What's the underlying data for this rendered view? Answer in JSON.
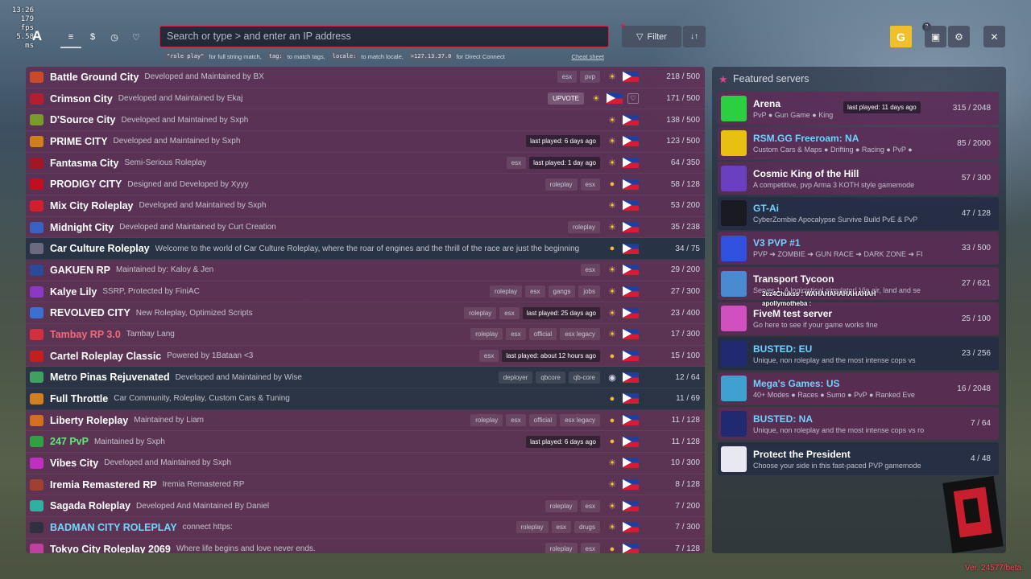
{
  "perf": {
    "time": "13:26",
    "fps": "179 fps",
    "ms": "5.58 ms"
  },
  "nav": {
    "logo": "A",
    "tabs": [
      {
        "icon": "list-icon",
        "glyph": "≡"
      },
      {
        "icon": "dollar-icon",
        "glyph": "$"
      },
      {
        "icon": "history-icon",
        "glyph": "◷"
      },
      {
        "icon": "heart-icon",
        "glyph": "♡"
      }
    ]
  },
  "search": {
    "placeholder": "Search or type > and enter an IP address",
    "hints": [
      {
        "code": "\"role play\"",
        "text": "for full string match,"
      },
      {
        "code": "tag:",
        "text": "to match tags,"
      },
      {
        "code": "locale:",
        "text": "to match locale,"
      },
      {
        "code": ">127.13.37.0",
        "text": "for Direct Connect"
      }
    ],
    "cheat": "Cheat sheet"
  },
  "toolbar": {
    "filter": "Filter",
    "sort_glyph": "↓↑",
    "avatar": "G",
    "notif_count": "2",
    "close_glyph": "✕",
    "settings_glyph": "⚙",
    "notif_glyph": "▣"
  },
  "colors": {
    "accent": "#d81e3c",
    "featured_star": "#e3418a"
  },
  "servers": [
    {
      "name": "Battle Ground City",
      "desc": "Developed and Maintained by BX",
      "tags": [
        "esx",
        "pvp"
      ],
      "players": "218 / 500",
      "style": "pink",
      "icon": "#c84a2a",
      "status": "sun"
    },
    {
      "name": "Crimson City",
      "desc": "Developed and Maintained by Ekaj",
      "upvote": "UPVOTE",
      "heart": true,
      "players": "171 / 500",
      "style": "pink",
      "icon": "#b02030",
      "status": "sun"
    },
    {
      "name": "D'Source City",
      "desc": "Developed and Maintained by Sxph",
      "players": "138 / 500",
      "style": "pink",
      "icon": "#7a9a2a",
      "status": "sun"
    },
    {
      "name": "PRIME CITY",
      "desc": "Developed and Maintained by Sxph",
      "last": "last played: 6 days ago",
      "players": "123 / 500",
      "style": "pink",
      "icon": "#d0801a",
      "status": "sun"
    },
    {
      "name": "Fantasma City",
      "desc": "Semi-Serious Roleplay",
      "tags": [
        "esx"
      ],
      "last": "last played: 1 day ago",
      "players": "64 / 350",
      "style": "pink",
      "icon": "#a01828",
      "status": "sun"
    },
    {
      "name": "PRODIGY CITY",
      "desc": "Designed and Developed by Xyyy",
      "tags": [
        "roleplay",
        "esx"
      ],
      "players": "58 / 128",
      "style": "pink",
      "icon": "#c01020",
      "status": "orb"
    },
    {
      "name": "Mix City Roleplay",
      "desc": "Developed and Maintained by Sxph",
      "players": "53 / 200",
      "style": "pink",
      "icon": "#d02030",
      "status": "sun"
    },
    {
      "name": "Midnight City",
      "desc": "Developed and Maintained by Curt Creation",
      "tags": [
        "roleplay"
      ],
      "players": "35 / 238",
      "style": "pink",
      "icon": "#3a60c0",
      "status": "sun"
    },
    {
      "name": "Car Culture Roleplay",
      "desc": "Welcome to the world of Car Culture Roleplay, where the roar of engines and the thrill of the race are just the beginning",
      "players": "34 / 75",
      "style": "blue",
      "icon": "#6a6a80",
      "status": "orb"
    },
    {
      "name": "GAKUEN RP",
      "desc": "Maintained by: Kaloy & Jen",
      "tags": [
        "esx"
      ],
      "players": "29 / 200",
      "style": "pink",
      "icon": "#2a4a9a",
      "status": "sun"
    },
    {
      "name": "Kalye Lily",
      "desc": "SSRP, Protected by FiniAC",
      "tags": [
        "roleplay",
        "esx",
        "gangs",
        "jobs"
      ],
      "players": "27 / 300",
      "style": "pink",
      "icon": "#8a3ac0",
      "status": "sun"
    },
    {
      "name": "REVOLVED CITY",
      "desc": "New Roleplay, Optimized Scripts",
      "tags": [
        "roleplay",
        "esx"
      ],
      "last": "last played: 25 days ago",
      "players": "23 / 400",
      "style": "pink",
      "icon": "#3a70d0",
      "status": "sun"
    },
    {
      "name": "Tambay RP 3.0",
      "desc": "Tambay Lang",
      "tags": [
        "roleplay",
        "esx",
        "official",
        "esx legacy"
      ],
      "players": "17 / 300",
      "style": "pink",
      "icon": "#d03040",
      "status": "sun",
      "color": "red"
    },
    {
      "name": "Cartel Roleplay Classic",
      "desc": "Powered by 1Bataan <3",
      "tags": [
        "esx"
      ],
      "last": "last played: about 12 hours ago",
      "players": "15 / 100",
      "style": "pink",
      "icon": "#c02020",
      "status": "orb"
    },
    {
      "name": "Metro Pinas Rejuvenated",
      "desc": "Developed and Maintained by Wise",
      "tags": [
        "deployer",
        "qbcore",
        "qb-core"
      ],
      "players": "12 / 64",
      "style": "blue",
      "icon": "#40a060",
      "status": "moon"
    },
    {
      "name": "Full Throttle",
      "desc": "Car Community, Roleplay, Custom Cars & Tuning",
      "players": "11 / 69",
      "style": "blue",
      "icon": "#d08020",
      "status": "orb"
    },
    {
      "name": "Liberty Roleplay",
      "desc": "Maintained by Liam",
      "tags": [
        "roleplay",
        "esx",
        "official",
        "esx legacy"
      ],
      "players": "11 / 128",
      "style": "pink",
      "icon": "#d07020",
      "status": "orb"
    },
    {
      "name": "247 PvP",
      "desc": "Maintained by Sxph",
      "last": "last played: 6 days ago",
      "players": "11 / 128",
      "style": "pink",
      "icon": "#30a040",
      "status": "orb",
      "color": "green"
    },
    {
      "name": "Vibes City",
      "desc": "Developed and Maintained by Sxph",
      "players": "10 / 300",
      "style": "pink",
      "icon": "#c030c0",
      "status": "sun"
    },
    {
      "name": "Iremia Remastered RP",
      "desc": "Iremia Remastered RP",
      "players": "8 / 128",
      "style": "pink",
      "icon": "#a04030",
      "status": "sun"
    },
    {
      "name": "Sagada Roleplay",
      "desc": "Developed And Maintained By Daniel",
      "tags": [
        "roleplay",
        "esx"
      ],
      "players": "7 / 200",
      "style": "pink",
      "icon": "#30b0a0",
      "status": "sun"
    },
    {
      "name": "BADMAN CITY ROLEPLAY",
      "desc": "connect https:",
      "tags": [
        "roleplay",
        "esx",
        "drugs"
      ],
      "players": "7 / 300",
      "style": "pink",
      "icon": "#303040",
      "status": "sun",
      "color": "cyan"
    },
    {
      "name": "Tokyo City Roleplay 2069",
      "desc": "Where life begins and love never ends.",
      "tags": [
        "roleplay",
        "esx"
      ],
      "players": "7 / 128",
      "style": "pink",
      "icon": "#c040a0",
      "status": "orb"
    }
  ],
  "featured": {
    "title": "Featured servers",
    "items": [
      {
        "name": "Arena",
        "desc": "PvP ● Gun Game ● King",
        "last": "last played: 11 days ago",
        "players": "315 / 2048",
        "style": "pink",
        "icon": "#2ad040"
      },
      {
        "name": "RSM.GG Freeroam: NA",
        "desc": "Custom Cars & Maps ● Drifting ● Racing ● PvP ●",
        "players": "85 / 2000",
        "style": "pink",
        "icon": "#e8c010",
        "cyan": true
      },
      {
        "name": "Cosmic King of the Hill",
        "desc": "A competitive, pvp Arma 3 KOTH style gamemode",
        "players": "57 / 300",
        "style": "pink",
        "icon": "#6a40c0"
      },
      {
        "name": "GT-Ai",
        "desc": "CyberZombie Apocalypse Survive Build PvE & PvP",
        "players": "47 / 128",
        "style": "blue",
        "icon": "#1a1a22",
        "cyan": true
      },
      {
        "name": "V3 PVP #1",
        "desc": "PVP ➔ ZOMBIE ➔ GUN RACE ➔ DARK ZONE ➔ FI",
        "players": "33 / 500",
        "style": "pink",
        "icon": "#3050e0",
        "cyan": true
      },
      {
        "name": "Transport Tycoon",
        "desc": "Server 1: A logicistical simulator! Via air, land and se",
        "players": "27 / 621",
        "style": "pink",
        "icon": "#4a8ad0"
      },
      {
        "name": "FiveM test server",
        "desc": "Go here to see if your game works fine",
        "players": "25 / 100",
        "style": "pink",
        "icon": "#d050c0"
      },
      {
        "name": "BUSTED: EU",
        "desc": "Unique, non roleplay and the most intense cops vs",
        "players": "23 / 256",
        "style": "blue",
        "icon": "#202a70",
        "cyan": true
      },
      {
        "name": "Mega's Games: US",
        "desc": "40+ Modes ● Races ● Sumo ● PvP ● Ranked Eve",
        "players": "16 / 2048",
        "style": "pink",
        "icon": "#40a0d0",
        "cyan": true
      },
      {
        "name": "BUSTED: NA",
        "desc": "Unique, non roleplay and the most intense cops vs ro",
        "players": "7 / 64",
        "style": "pink",
        "icon": "#202a70",
        "cyan": true
      },
      {
        "name": "Protect the President",
        "desc": "Choose your side in this fast-paced PVP gamemode",
        "players": "4 / 48",
        "style": "blue",
        "icon": "#e8e8f0"
      }
    ]
  },
  "chat": {
    "line1": "2ez4Chukss : WAHAHAHAHAHAHAH",
    "line2": "apollymotheba :"
  },
  "version": "Ver. 24577/beta"
}
